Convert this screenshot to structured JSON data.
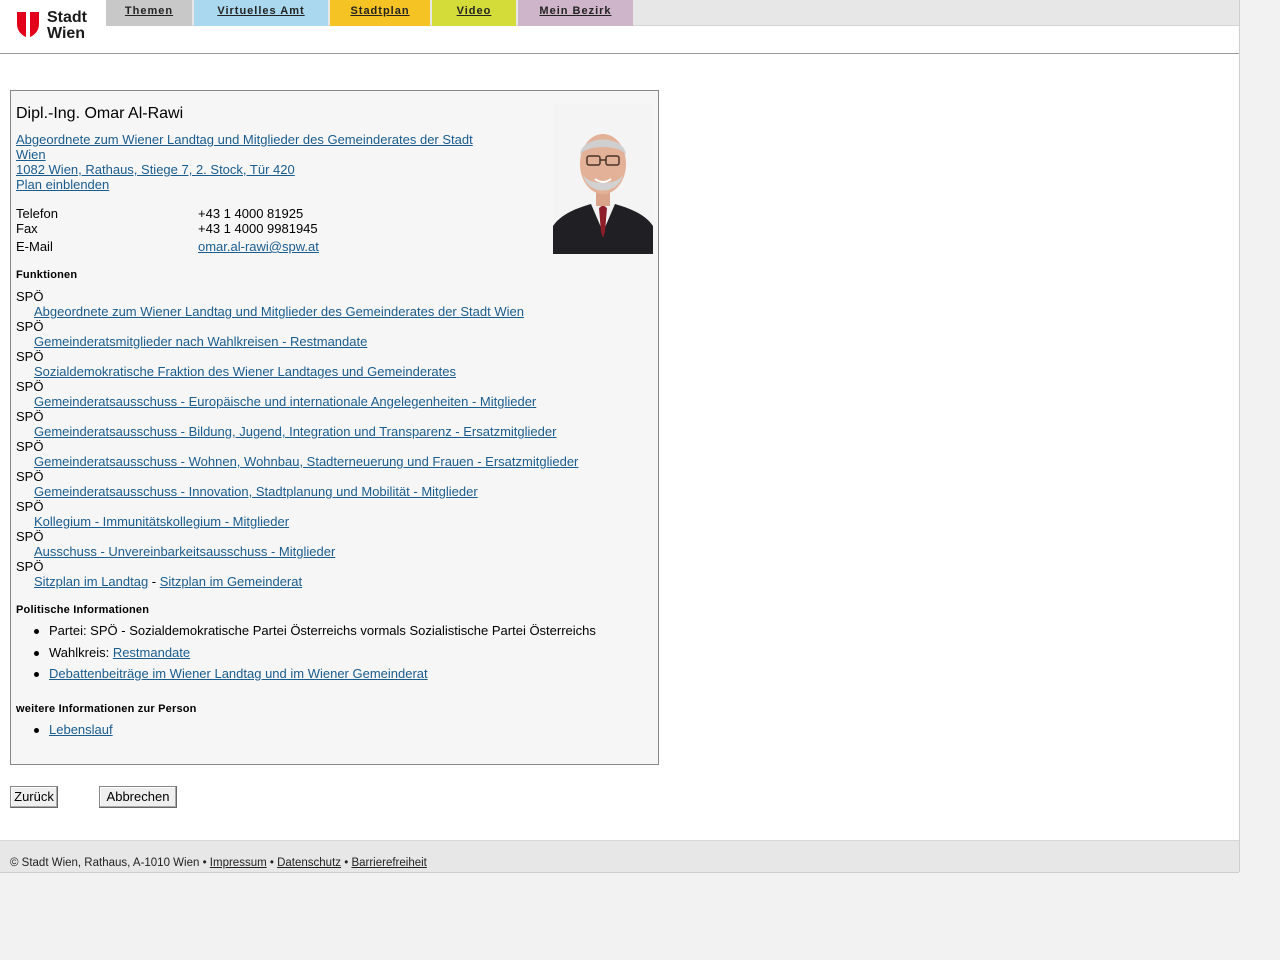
{
  "logo": {
    "line1": "Stadt",
    "line2": "Wien"
  },
  "nav": {
    "tabs": [
      {
        "label": "Themen",
        "color": "#c8c8c8"
      },
      {
        "label": "Virtuelles Amt",
        "color": "#a9d8ef"
      },
      {
        "label": "Stadtplan",
        "color": "#f5c324"
      },
      {
        "label": "Video",
        "color": "#d4dc3a"
      },
      {
        "label": "Mein Bezirk",
        "color": "#cfb5c9"
      }
    ]
  },
  "person": {
    "name": "Dipl.-Ing. Omar Al-Rawi",
    "org_line1": "Abgeordnete zum Wiener Landtag und Mitglieder des Gemeinderates der Stadt",
    "org_line2": "Wien ",
    "address": "1082 Wien, Rathaus, Stiege 7, 2. Stock, Tür 420",
    "plan_link": "Plan einblenden",
    "contacts": [
      {
        "label": "Telefon",
        "value": "+43 1 4000 81925"
      },
      {
        "label": "Fax",
        "value": "+43 1 4000 9981945"
      },
      {
        "label": "E-Mail",
        "value": "omar.al-rawi@spw.at"
      }
    ]
  },
  "functions": {
    "heading": "Funktionen",
    "items": [
      {
        "party": "SPÖ",
        "label": "Abgeordnete zum Wiener Landtag und Mitglieder des Gemeinderates der Stadt Wien"
      },
      {
        "party": "SPÖ",
        "label": "Gemeinderatsmitglieder nach Wahlkreisen - Restmandate"
      },
      {
        "party": "SPÖ",
        "label": "Sozialdemokratische Fraktion des Wiener Landtages und Gemeinderates"
      },
      {
        "party": "SPÖ",
        "label": "Gemeinderatsausschuss - Europäische und internationale Angelegenheiten - Mitglieder"
      },
      {
        "party": "SPÖ",
        "label": "Gemeinderatsausschuss - Bildung, Jugend, Integration und Transparenz - Ersatzmitglieder"
      },
      {
        "party": "SPÖ",
        "label": "Gemeinderatsausschuss - Wohnen, Wohnbau, Stadterneuerung und Frauen - Ersatzmitglieder"
      },
      {
        "party": "SPÖ",
        "label": "Gemeinderatsausschuss - Innovation, Stadtplanung und Mobilität - Mitglieder"
      },
      {
        "party": "SPÖ",
        "label": "Kollegium - Immunitätskollegium - Mitglieder"
      },
      {
        "party": "SPÖ",
        "label": "Ausschuss - Unvereinbarkeitsausschuss - Mitglieder"
      }
    ],
    "last_party": "SPÖ",
    "sitzplan_landtag": "Sitzplan im Landtag",
    "separator": " - ",
    "sitzplan_gemeinderat": "Sitzplan im Gemeinderat"
  },
  "political": {
    "heading": "Politische Informationen",
    "party": "Partei: SPÖ - Sozialdemokratische Partei Österreichs vormals Sozialistische Partei Österreichs",
    "wahlkreis_label": "Wahlkreis: ",
    "wahlkreis_link": "Restmandate",
    "debatten": "Debattenbeiträge im Wiener Landtag und im Wiener Gemeinderat"
  },
  "more": {
    "heading": "weitere Informationen zur Person",
    "lebenslauf": "Lebenslauf"
  },
  "buttons": {
    "back": "Zurück",
    "cancel": "Abbrechen"
  },
  "footer": {
    "copyright": "© Stadt Wien, Rathaus, A-1010 Wien • ",
    "impressum": "Impressum",
    "sep": " • ",
    "datenschutz": "Datenschutz",
    "barrierefreiheit": "Barrierefreiheit"
  }
}
